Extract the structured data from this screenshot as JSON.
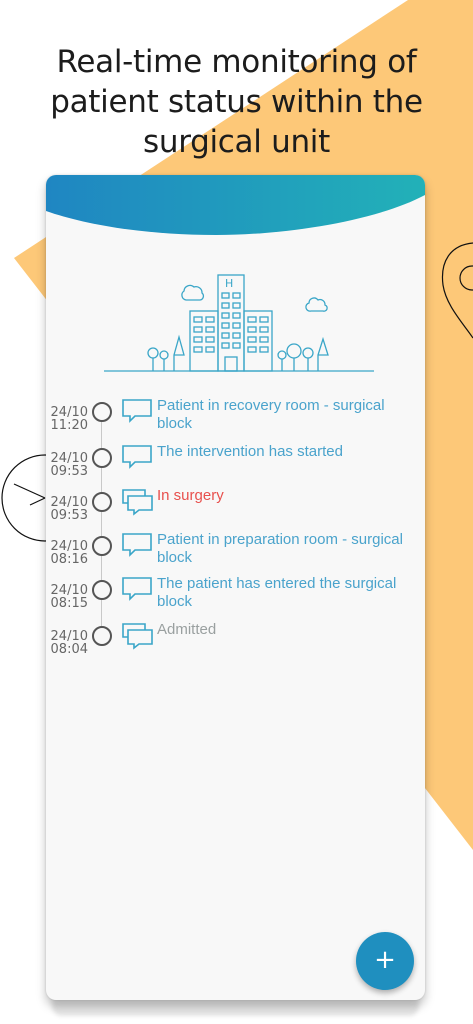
{
  "headline": {
    "line1": "Real-time monitoring of",
    "line2": "patient status within the",
    "line3": "surgical unit"
  },
  "colors": {
    "accent_yellow": "#fdc878",
    "header_gradient_start": "#1f86c2",
    "header_gradient_end": "#22b1b8",
    "link_blue": "#4aa3cc",
    "alert_red": "#e8504d",
    "fab_blue": "#1f8fbf"
  },
  "timeline": [
    {
      "date": "24/10",
      "time": "11:20",
      "text": "Patient in recovery room - surgical block",
      "icon": "chat-bubble-icon",
      "status": "info"
    },
    {
      "date": "24/10",
      "time": "09:53",
      "text": "The intervention has started",
      "icon": "chat-bubble-icon",
      "status": "info"
    },
    {
      "date": "24/10",
      "time": "09:53",
      "text": "In surgery",
      "icon": "chat-bubbles-icon",
      "status": "alert"
    },
    {
      "date": "24/10",
      "time": "08:16",
      "text": "Patient in preparation room - surgical block",
      "icon": "chat-bubble-icon",
      "status": "info"
    },
    {
      "date": "24/10",
      "time": "08:15",
      "text": "The patient has entered the surgical block",
      "icon": "chat-bubble-icon",
      "status": "info"
    },
    {
      "date": "24/10",
      "time": "08:04",
      "text": "Admitted",
      "icon": "chat-bubbles-icon",
      "status": "done"
    }
  ],
  "fab": {
    "label": "+",
    "icon": "plus-icon"
  }
}
